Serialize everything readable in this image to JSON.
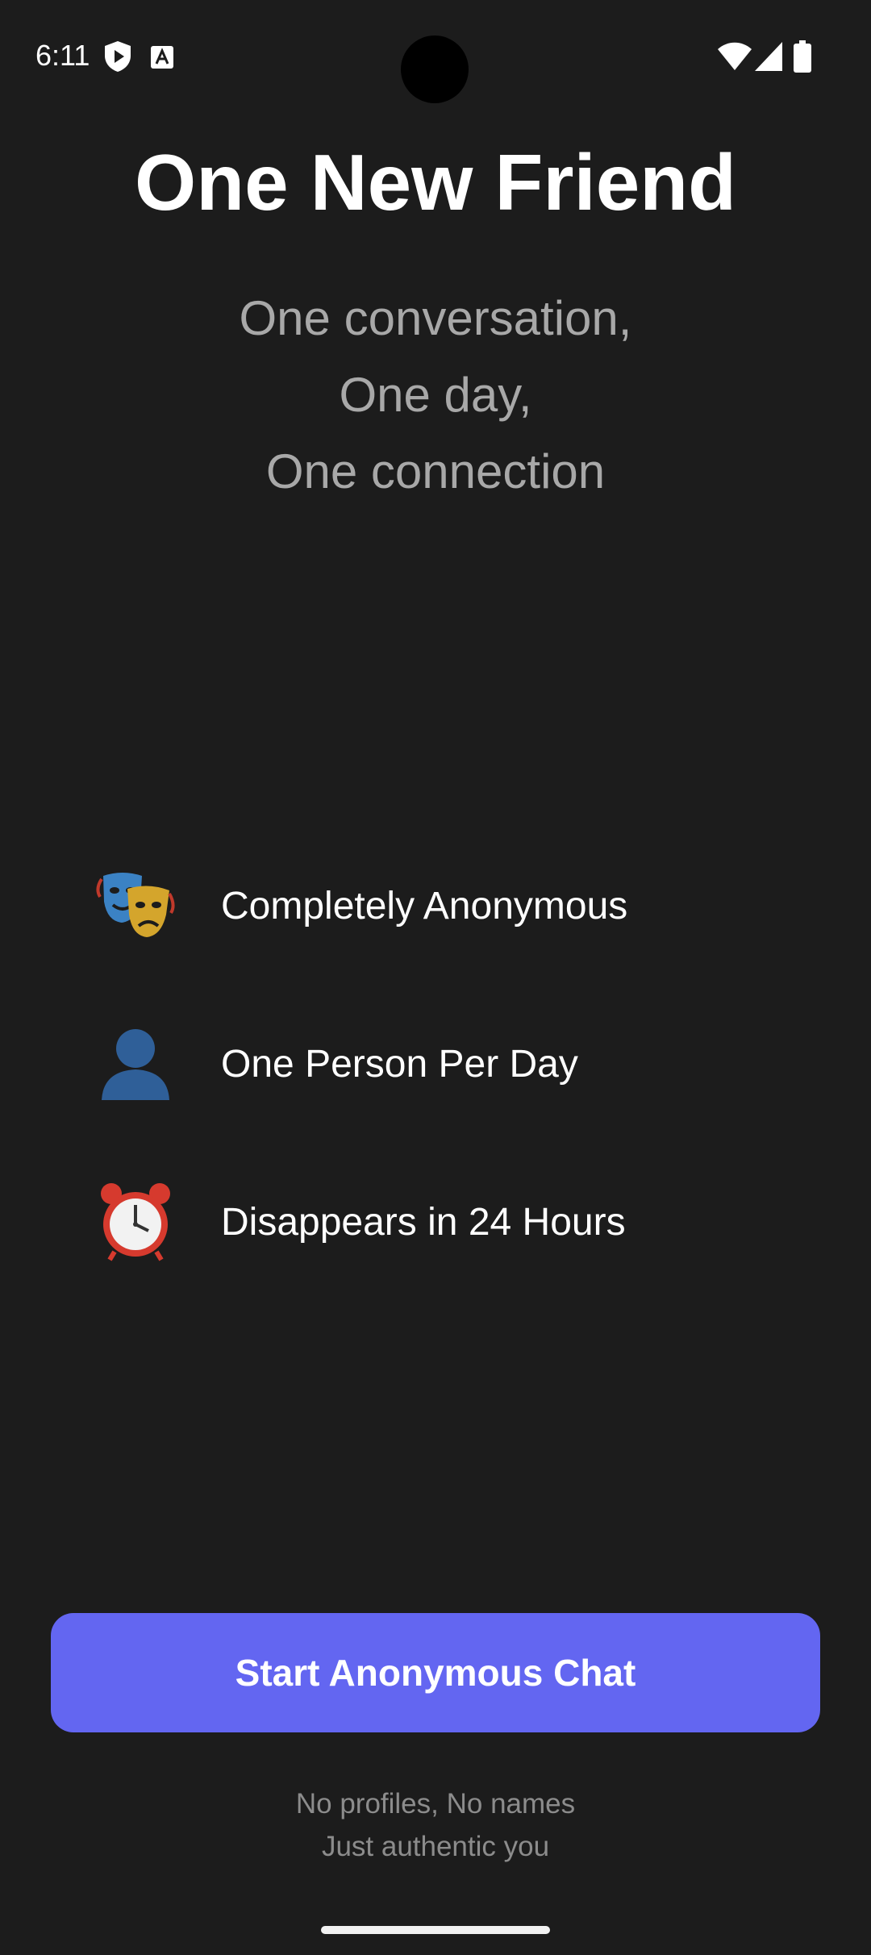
{
  "status_bar": {
    "time": "6:11",
    "left_icons": [
      "shield-play-icon",
      "text-a-icon"
    ],
    "right_icons": [
      "wifi-icon",
      "cell-signal-icon",
      "battery-icon"
    ]
  },
  "header": {
    "title": "One New Friend"
  },
  "tagline": {
    "lines": [
      "One conversation,",
      "One day,",
      "One connection"
    ]
  },
  "features": [
    {
      "icon": "theater-masks-icon",
      "label": "Completely Anonymous"
    },
    {
      "icon": "person-silhouette-icon",
      "label": "One Person Per Day"
    },
    {
      "icon": "alarm-clock-icon",
      "label": "Disappears in 24 Hours"
    }
  ],
  "cta": {
    "label": "Start Anonymous Chat",
    "color": "#6366f1"
  },
  "footnote": {
    "lines": [
      "No profiles, No names",
      "Just authentic you"
    ]
  },
  "colors": {
    "background": "#1c1c1c",
    "muted_text": "#a8a8a8",
    "accent": "#6366f1"
  }
}
